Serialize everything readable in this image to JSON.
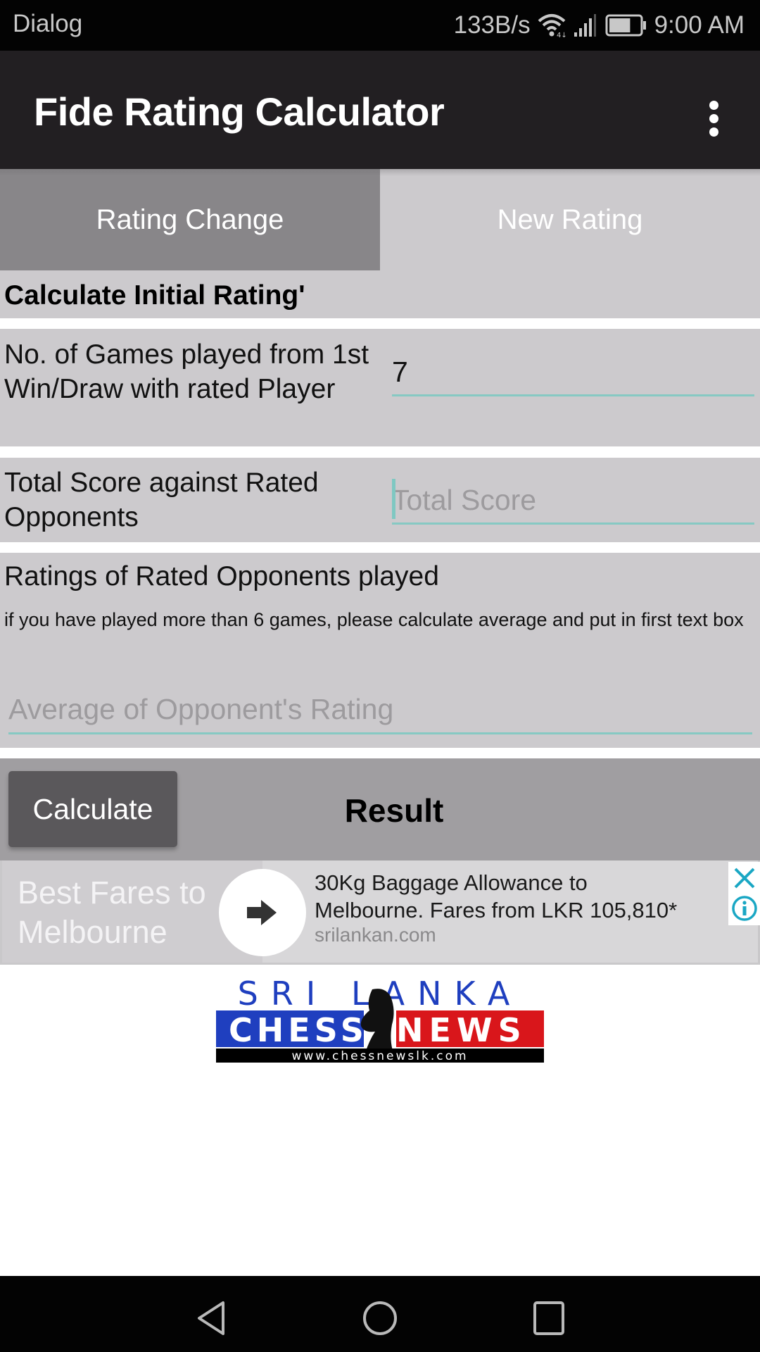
{
  "status_bar": {
    "left_label": "Dialog",
    "network_speed": "133B/s",
    "time": "9:00 AM",
    "battery_level_percent": 70,
    "icons": [
      "wifi-icon",
      "signal-icon",
      "battery-icon"
    ]
  },
  "app_bar": {
    "title": "Fide Rating Calculator",
    "overflow_icon": "more-vert-icon"
  },
  "tabs": [
    {
      "label": "Rating Change",
      "active": true
    },
    {
      "label": "New Rating",
      "active": false
    }
  ],
  "form": {
    "heading": "Calculate Initial Rating'",
    "games_played": {
      "label": "No. of Games played from 1st Win/Draw with rated Player",
      "value": "7",
      "placeholder": ""
    },
    "total_score": {
      "label": "Total Score against Rated Opponents",
      "value": "",
      "placeholder": "Total Score"
    },
    "opponent_ratings": {
      "label": "Ratings of Rated Opponents played",
      "note": "if you have played more than 6 games, please calculate average and put in first text box",
      "value": "",
      "placeholder": "Average of Opponent's Rating"
    }
  },
  "result_bar": {
    "calculate_label": "Calculate",
    "result_label": "Result"
  },
  "ad": {
    "headline": "Best Fares to Melbourne",
    "body": "30Kg Baggage Allowance to Melbourne. Fares from LKR 105,810*",
    "body_line1": "30Kg Baggage Allowance to",
    "body_line2": "Melbourne. Fares from LKR 105,810*",
    "domain": "srilankan.com",
    "arrow_icon": "arrow-right-icon",
    "close_icon": "close-icon",
    "info_icon": "info-icon",
    "accent_color": "#1aa7c4"
  },
  "logo": {
    "line1": "SRI LANKA",
    "word_left": "CHESS",
    "word_right": "NEWS",
    "url": "www.chessnewslk.com",
    "colors": {
      "blue": "#1f3fbf",
      "red": "#d9161b",
      "black": "#000000"
    }
  },
  "nav_bar": {
    "buttons": [
      "back-icon",
      "home-icon",
      "recents-icon"
    ]
  },
  "colors": {
    "accent_teal": "#86c9c3",
    "app_bar": "#221f22",
    "tab_active": "#888689",
    "surface": "#cccacd"
  }
}
